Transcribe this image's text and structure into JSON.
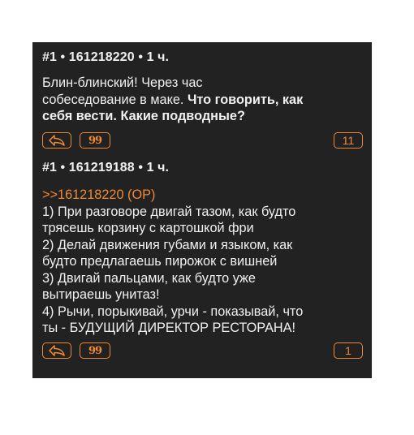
{
  "post1": {
    "header": "#1 • 161218220 • 1 ч.",
    "text_plain": "Блин-блинский! Через час собеседование в маке. ",
    "text_line1": "Блин-блинский! Через час",
    "text_line2_plain": "собеседование в маке. ",
    "text_line2_bold": "Что говорить, как",
    "text_line3_bold": "себя вести. Какие подводные?",
    "reply_icon": "reply-icon",
    "quote_icon": "quote-icon",
    "quote_glyph": "99",
    "count": "11"
  },
  "post2": {
    "header": "#1 • 161219188 • 1 ч.",
    "reply_ref": ">>161218220 (OP)",
    "lines": [
      "1) При разговоре двигай тазом, как будто",
      "трясешь корзину с картошкой фри",
      "2) Делай движения губами и языком, как",
      "будто предлагаешь пирожок с вишней",
      "3) Двигай пальцами, как будто уже",
      "вытираешь унитаз!",
      "4) Рычи, порыкивай, урчи - показывай, что",
      "ты - БУДУЩИЙ ДИРЕКТОР РЕСТОРАНА!"
    ],
    "reply_icon": "reply-icon",
    "quote_icon": "quote-icon",
    "quote_glyph": "99",
    "count": "1"
  },
  "colors": {
    "panel": "#222222",
    "accent": "#ef8a34",
    "text": "#f0f0f0",
    "page": "#ffffff"
  }
}
